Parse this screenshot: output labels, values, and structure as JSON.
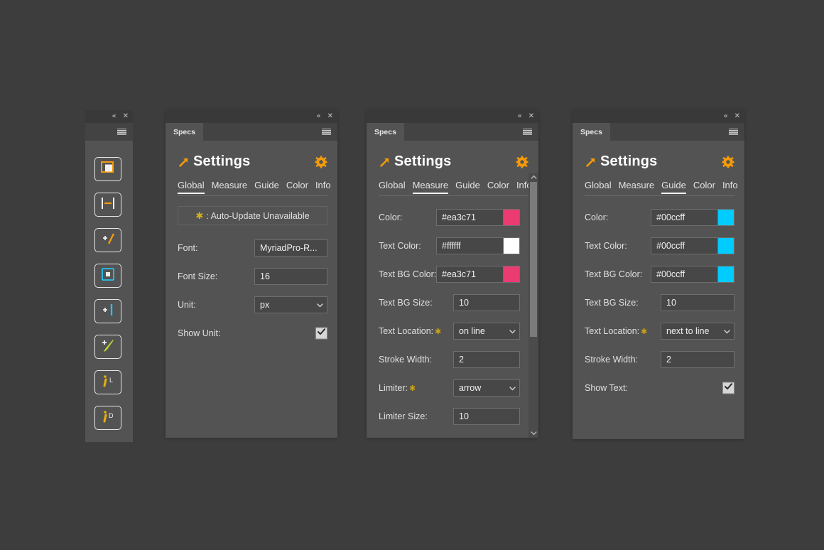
{
  "app": {
    "background_color": "#3d3d3d",
    "panel_bg": "#535353",
    "accent_orange": "#f59b0b",
    "star_gold": "#d8b21a"
  },
  "toolstrip": {
    "name": "Specs tool strip",
    "collapse_label": "«",
    "close_label": "✕",
    "tools": [
      {
        "name": "artboard-spec-tool",
        "icon": "artboard-icon"
      },
      {
        "name": "width-measure-tool",
        "icon": "horizontal-measure-icon"
      },
      {
        "name": "add-diagonal-measure-tool",
        "icon": "add-diagonal-icon"
      },
      {
        "name": "area-spec-tool",
        "icon": "area-bounds-icon"
      },
      {
        "name": "add-guide-tool",
        "icon": "add-vertical-guide-icon"
      },
      {
        "name": "add-note-tool",
        "icon": "add-pen-icon"
      },
      {
        "name": "info-layer-tool",
        "icon": "info-layer-icon"
      },
      {
        "name": "info-document-tool",
        "icon": "info-document-icon"
      }
    ]
  },
  "panels": [
    {
      "id": "panel-global",
      "tab_label": "Specs",
      "collapse_label": "«",
      "close_label": "✕",
      "title": "Settings",
      "tabs": [
        {
          "label": "Global",
          "active": true
        },
        {
          "label": "Measure",
          "active": false
        },
        {
          "label": "Guide",
          "active": false
        },
        {
          "label": "Color",
          "active": false
        },
        {
          "label": "Info",
          "active": false
        }
      ],
      "notice": {
        "star": "✱",
        "text": ": Auto-Update Unavailable"
      },
      "rows": [
        {
          "kind": "text",
          "label": "Font:",
          "value": "MyriadPro-R...",
          "field_width": 103
        },
        {
          "kind": "text",
          "label": "Font Size:",
          "value": "16",
          "field_width": 103
        },
        {
          "kind": "select",
          "label": "Unit:",
          "value": "px",
          "field_width": 103
        },
        {
          "kind": "checkbox",
          "label": "Show Unit:",
          "checked": true
        }
      ],
      "scrollbar": false
    },
    {
      "id": "panel-measure",
      "tab_label": "Specs",
      "collapse_label": "«",
      "close_label": "✕",
      "title": "Settings",
      "tabs": [
        {
          "label": "Global",
          "active": false
        },
        {
          "label": "Measure",
          "active": true
        },
        {
          "label": "Guide",
          "active": false
        },
        {
          "label": "Color",
          "active": false
        },
        {
          "label": "Info",
          "active": false
        }
      ],
      "rows": [
        {
          "kind": "color",
          "label": "Color:",
          "value": "#ea3c71",
          "swatch": "#ea3c71",
          "field_width": 94
        },
        {
          "kind": "color",
          "label": "Text Color:",
          "value": "#ffffff",
          "swatch": "#ffffff",
          "field_width": 94
        },
        {
          "kind": "color",
          "label": "Text BG Color:",
          "value": "#ea3c71",
          "swatch": "#ea3c71",
          "field_width": 94
        },
        {
          "kind": "text",
          "label": "Text BG Size:",
          "value": "10",
          "field_width": 94
        },
        {
          "kind": "select",
          "label": "Text Location:",
          "required": true,
          "value": "on line",
          "field_width": 94
        },
        {
          "kind": "text",
          "label": "Stroke Width:",
          "value": "2",
          "field_width": 94
        },
        {
          "kind": "select",
          "label": "Limiter:",
          "required": true,
          "value": "arrow",
          "field_width": 94
        },
        {
          "kind": "text",
          "label": "Limiter Size:",
          "value": "10",
          "field_width": 94
        }
      ],
      "scrollbar": true,
      "scrollbar_up": "⌃",
      "scrollbar_down": "⌄"
    },
    {
      "id": "panel-guide",
      "tab_label": "Specs",
      "collapse_label": "«",
      "close_label": "✕",
      "title": "Settings",
      "tabs": [
        {
          "label": "Global",
          "active": false
        },
        {
          "label": "Measure",
          "active": false
        },
        {
          "label": "Guide",
          "active": true
        },
        {
          "label": "Color",
          "active": false
        },
        {
          "label": "Info",
          "active": false
        }
      ],
      "rows": [
        {
          "kind": "color",
          "label": "Color:",
          "value": "#00ccff",
          "swatch": "#00ccff",
          "field_width": 94
        },
        {
          "kind": "color",
          "label": "Text Color:",
          "value": "#00ccff",
          "swatch": "#00ccff",
          "field_width": 94
        },
        {
          "kind": "color",
          "label": "Text BG Color:",
          "value": "#00ccff",
          "swatch": "#00ccff",
          "field_width": 94
        },
        {
          "kind": "text",
          "label": "Text BG Size:",
          "value": "10",
          "field_width": 104
        },
        {
          "kind": "select",
          "label": "Text Location:",
          "required": true,
          "value": "next to line",
          "field_width": 104
        },
        {
          "kind": "text",
          "label": "Stroke Width:",
          "value": "2",
          "field_width": 104
        },
        {
          "kind": "checkbox",
          "label": "Show Text:",
          "checked": true
        }
      ],
      "scrollbar": false
    }
  ]
}
